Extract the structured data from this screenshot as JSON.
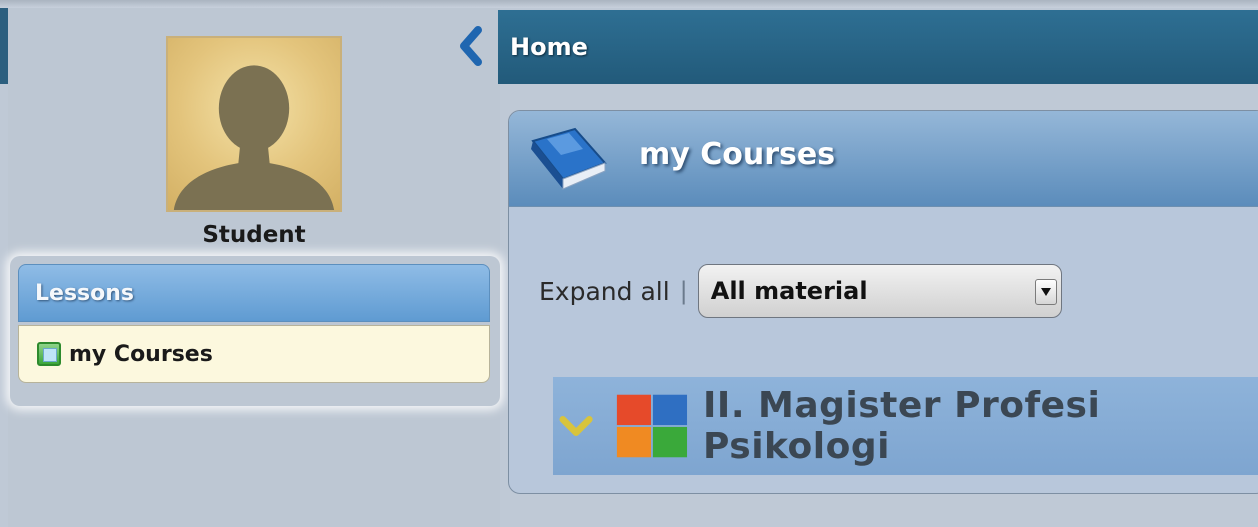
{
  "header": {
    "title": "Home"
  },
  "profile": {
    "name": "Student",
    "avatar_icon": "user-silhouette-icon"
  },
  "sidebar": {
    "section_title": "Lessons",
    "items": [
      {
        "label": "my Courses",
        "icon": "course-icon"
      }
    ]
  },
  "panel": {
    "title": "my Courses",
    "icon": "book-icon",
    "expand_all": "Expand all",
    "separator": "|",
    "filter": {
      "selected": "All material"
    },
    "courses": [
      {
        "name": "II. Magister Profesi Psikologi",
        "expanded": true
      }
    ]
  },
  "colors": {
    "header_bg": "#2e6f93",
    "lessons_header": "#6fa4d6",
    "lessons_item_bg": "#fcf8de",
    "panel_header": "#6f9cc7",
    "course_row": "#86acd5"
  }
}
